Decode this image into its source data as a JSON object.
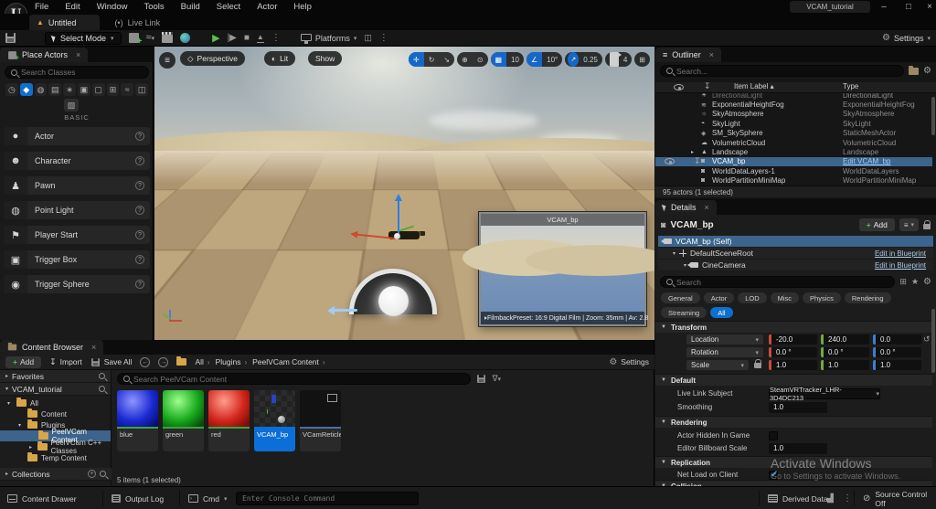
{
  "window": {
    "title": "VCAM_tutorial",
    "menus": [
      "File",
      "Edit",
      "Window",
      "Tools",
      "Build",
      "Select",
      "Actor",
      "Help"
    ],
    "doc_tab": "Untitled",
    "live_link_tab": "Live Link",
    "minimize": "–",
    "restore": "□",
    "close": "×"
  },
  "toolbar": {
    "select_mode_label": "Select Mode",
    "platforms_label": "Platforms",
    "settings_label": "Settings"
  },
  "place_actors": {
    "tab_title": "Place Actors",
    "search_placeholder": "Search Classes",
    "category_label": "BASIC",
    "categories": [
      {
        "icon": "◷",
        "cls": ""
      },
      {
        "icon": "◆",
        "cls": "active"
      },
      {
        "icon": "◍",
        "cls": ""
      },
      {
        "icon": "▤",
        "cls": ""
      },
      {
        "icon": "∗",
        "cls": ""
      },
      {
        "icon": "▣",
        "cls": ""
      },
      {
        "icon": "▢",
        "cls": ""
      },
      {
        "icon": "⊞",
        "cls": ""
      },
      {
        "icon": "≈",
        "cls": ""
      },
      {
        "icon": "◫",
        "cls": ""
      }
    ],
    "floating_category_icon": "▧",
    "items": [
      {
        "icon": "●",
        "label": "Actor"
      },
      {
        "icon": "☻",
        "label": "Character"
      },
      {
        "icon": "♟",
        "label": "Pawn"
      },
      {
        "icon": "◍",
        "label": "Point Light"
      },
      {
        "icon": "⚑",
        "label": "Player Start"
      },
      {
        "icon": "▣",
        "label": "Trigger Box"
      },
      {
        "icon": "◉",
        "label": "Trigger Sphere"
      }
    ]
  },
  "viewport": {
    "perspective_label": "Perspective",
    "lit_label": "Lit",
    "show_label": "Show",
    "grid_snap_value": "10",
    "angle_snap_value": "10°",
    "scale_snap_value": "0.25",
    "camera_speed_value": "4",
    "pip": {
      "title": "VCAM_bp",
      "caption": "FilmbackPreset: 16:9 Digital Film | Zoom: 35mm | Av: 2.8"
    }
  },
  "outliner": {
    "tab_title": "Outliner",
    "search_placeholder": "Search...",
    "item_label_header": "Item Label ▴",
    "type_header": "Type",
    "rows": [
      {
        "icon": "☀",
        "label": "DirectionalLight",
        "type": "DirectionalLight",
        "cls": "cut"
      },
      {
        "icon": "≋",
        "label": "ExponentialHeightFog",
        "type": "ExponentialHeightFog",
        "cls": ""
      },
      {
        "icon": "☼",
        "label": "SkyAtmosphere",
        "type": "SkyAtmosphere",
        "cls": ""
      },
      {
        "icon": "◓",
        "label": "SkyLight",
        "type": "SkyLight",
        "cls": ""
      },
      {
        "icon": "◈",
        "label": "SM_SkySphere",
        "type": "StaticMeshActor",
        "cls": ""
      },
      {
        "icon": "☁",
        "label": "VolumetricCloud",
        "type": "VolumetricCloud",
        "cls": ""
      },
      {
        "icon": "▲",
        "label": "Landscape",
        "type": "Landscape",
        "cls": "expandable"
      },
      {
        "icon": "◙",
        "label": "VCAM_bp",
        "type": "Edit VCAM_bp",
        "cls": "selected"
      },
      {
        "icon": "◙",
        "label": "WorldDataLayers-1",
        "type": "WorldDataLayers",
        "cls": ""
      },
      {
        "icon": "◙",
        "label": "WorldPartitionMiniMap",
        "type": "WorldPartitionMiniMap",
        "cls": ""
      }
    ],
    "footer": "95 actors (1 selected)"
  },
  "details": {
    "tab_title": "Details",
    "actor_name": "VCAM_bp",
    "add_label": "Add",
    "tree": [
      {
        "label": "VCAM_bp (Self)",
        "link": "",
        "cls": "selected cam"
      },
      {
        "label": "DefaultSceneRoot",
        "link": "Edit in Blueprint",
        "cls": "lvl1 axes"
      },
      {
        "label": "CineCamera",
        "link": "Edit in Blueprint",
        "cls": "lvl2 cam"
      }
    ],
    "search_placeholder": "Search",
    "filter_tabs": [
      {
        "label": "General",
        "cls": ""
      },
      {
        "label": "Actor",
        "cls": ""
      },
      {
        "label": "LOD",
        "cls": ""
      },
      {
        "label": "Misc",
        "cls": ""
      },
      {
        "label": "Physics",
        "cls": ""
      },
      {
        "label": "Rendering",
        "cls": ""
      },
      {
        "label": "Streaming",
        "cls": ""
      },
      {
        "label": "All",
        "cls": "all"
      }
    ],
    "sections": {
      "transform": "Transform",
      "default": "Default",
      "rendering": "Rendering",
      "replication": "Replication",
      "collision": "Collision"
    },
    "transform_rows": {
      "location": {
        "label": "Location",
        "x": "-20.0",
        "y": "240.0",
        "z": "0.0"
      },
      "rotation": {
        "label": "Rotation",
        "x": "0.0 °",
        "y": "0.0 °",
        "z": "0.0 °"
      },
      "scale": {
        "label": "Scale",
        "x": "1.0",
        "y": "1.0",
        "z": "1.0"
      }
    },
    "default_props": {
      "live_link_label": "Live Link Subject",
      "live_link_value": "SteamVRTracker_LHR-3D4DC213",
      "smoothing_label": "Smoothing",
      "smoothing_value": "1.0"
    },
    "rendering_props": {
      "hidden_label": "Actor Hidden In Game",
      "billboard_label": "Editor Billboard Scale",
      "billboard_value": "1.0"
    },
    "replication_props": {
      "net_load_label": "Net Load on Client"
    }
  },
  "content_browser": {
    "tab_title": "Content Browser",
    "add_label": "Add",
    "import_label": "Import",
    "save_all_label": "Save All",
    "breadcrumbs": [
      {
        "label": "All"
      },
      {
        "label": "Plugins"
      },
      {
        "label": "PeelVCam Content"
      }
    ],
    "settings_label": "Settings",
    "favorites_label": "Favorites",
    "project_label": "VCAM_tutorial",
    "tree": [
      {
        "label": "All",
        "cls": "lvl0 open"
      },
      {
        "label": "Content",
        "cls": "lvl1"
      },
      {
        "label": "Plugins",
        "cls": "lvl1 open"
      },
      {
        "label": "PeelVCam Content",
        "cls": "lvl2 selected"
      },
      {
        "label": "PeelVCam C++ Classes",
        "cls": "lvl2 expandable"
      },
      {
        "label": "Temp Content",
        "cls": "lvl1"
      }
    ],
    "collections_label": "Collections",
    "search_placeholder": "Search PeelVCam Content",
    "assets": [
      {
        "label": "blue",
        "cls": "sphere-blue"
      },
      {
        "label": "green",
        "cls": "sphere-green"
      },
      {
        "label": "red",
        "cls": "sphere-red"
      },
      {
        "label": "VCAM_bp",
        "cls": "bp selected"
      },
      {
        "label": "VCamReticle",
        "cls": "reticle"
      }
    ],
    "footer": "5 items (1 selected)"
  },
  "status_bar": {
    "content_drawer_label": "Content Drawer",
    "output_log_label": "Output Log",
    "cmd_label": "Cmd",
    "console_placeholder": "Enter Console Command",
    "derived_data_label": "Derived Data",
    "source_control_label": "Source Control Off"
  },
  "watermark": {
    "line1": "Activate Windows",
    "line2": "Go to Settings to activate Windows."
  },
  "colors": {
    "accent_blue": "#0f6fce",
    "selection_steel": "#3c648c",
    "axis_x_red": "#c94c3b",
    "axis_y_green": "#77a83a",
    "axis_z_blue": "#3b7fd0",
    "folder_orange": "#d8a548",
    "play_green": "#57c24f"
  }
}
